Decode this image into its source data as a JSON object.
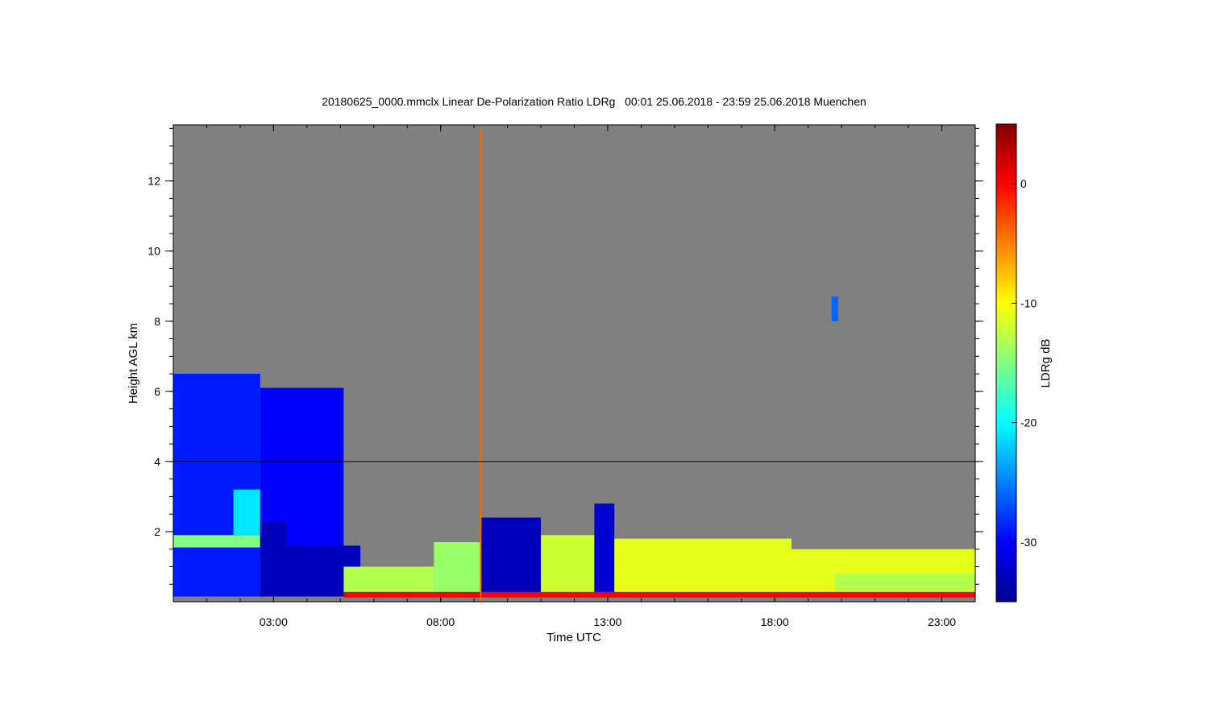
{
  "chart_data": {
    "type": "heatmap",
    "title": "20180625_0000.mmclx Linear De-Polarization Ratio LDRg   00:01 25.06.2018 - 23:59 25.06.2018 Muenchen",
    "xlabel": "Time UTC",
    "ylabel": "Height AGL km",
    "colorbar_label": "LDRg dB",
    "x_range_hours": [
      0.0,
      24.0
    ],
    "y_range_km": [
      0.0,
      13.6
    ],
    "x_ticks": [
      {
        "value": 3,
        "label": "03:00"
      },
      {
        "value": 8,
        "label": "08:00"
      },
      {
        "value": 13,
        "label": "13:00"
      },
      {
        "value": 18,
        "label": "18:00"
      },
      {
        "value": 23,
        "label": "23:00"
      }
    ],
    "y_ticks": [
      {
        "value": 2,
        "label": "2"
      },
      {
        "value": 4,
        "label": "4"
      },
      {
        "value": 6,
        "label": "6"
      },
      {
        "value": 8,
        "label": "8"
      },
      {
        "value": 10,
        "label": "10"
      },
      {
        "value": 12,
        "label": "12"
      }
    ],
    "colorbar_range_db": [
      -35,
      5
    ],
    "colorbar_ticks": [
      {
        "value": 0,
        "label": "0"
      },
      {
        "value": -10,
        "label": "-10"
      },
      {
        "value": -20,
        "label": "-20"
      },
      {
        "value": -30,
        "label": "-30"
      }
    ],
    "colormap": [
      "#00008f",
      "#0000ff",
      "#0080ff",
      "#00ffff",
      "#80ff80",
      "#ffff00",
      "#ff8000",
      "#ff0000",
      "#800000"
    ],
    "background_color": "#808080",
    "reference_line_km": 4.0,
    "regions": [
      {
        "t0": 0.0,
        "t1": 2.6,
        "h0": 0.15,
        "h1": 6.5,
        "ldr_db": -29
      },
      {
        "t0": 2.6,
        "t1": 5.1,
        "h0": 0.15,
        "h1": 6.1,
        "ldr_db": -30
      },
      {
        "t0": 0.0,
        "t1": 2.6,
        "h0": 1.55,
        "h1": 1.9,
        "ldr_db": -15
      },
      {
        "t0": 1.8,
        "t1": 2.6,
        "h0": 1.9,
        "h1": 3.2,
        "ldr_db": -21
      },
      {
        "t0": 2.6,
        "t1": 3.4,
        "h0": 0.15,
        "h1": 2.3,
        "ldr_db": -33
      },
      {
        "t0": 3.4,
        "t1": 5.6,
        "h0": 0.15,
        "h1": 1.6,
        "ldr_db": -33
      },
      {
        "t0": 5.1,
        "t1": 7.8,
        "h0": 0.15,
        "h1": 1.0,
        "ldr_db": -13
      },
      {
        "t0": 7.8,
        "t1": 9.2,
        "h0": 0.15,
        "h1": 1.7,
        "ldr_db": -14
      },
      {
        "t0": 9.2,
        "t1": 11.0,
        "h0": 0.2,
        "h1": 2.4,
        "ldr_db": -33
      },
      {
        "t0": 11.0,
        "t1": 12.6,
        "h0": 0.15,
        "h1": 1.9,
        "ldr_db": -12
      },
      {
        "t0": 12.6,
        "t1": 13.2,
        "h0": 0.2,
        "h1": 2.8,
        "ldr_db": -32
      },
      {
        "t0": 13.2,
        "t1": 18.5,
        "h0": 0.15,
        "h1": 1.8,
        "ldr_db": -11
      },
      {
        "t0": 18.5,
        "t1": 24.0,
        "h0": 0.15,
        "h1": 1.5,
        "ldr_db": -11
      },
      {
        "t0": 19.8,
        "t1": 24.0,
        "h0": 0.3,
        "h1": 0.8,
        "ldr_db": -13
      },
      {
        "t0": 5.1,
        "t1": 24.0,
        "h0": 0.12,
        "h1": 0.28,
        "ldr_db": 0
      },
      {
        "t0": 19.7,
        "t1": 19.9,
        "h0": 8.0,
        "h1": 8.7,
        "ldr_db": -26
      }
    ],
    "vertical_artifact": {
      "t": 9.2,
      "h0": 0.0,
      "h1": 13.5,
      "ldr_db": -4
    }
  }
}
